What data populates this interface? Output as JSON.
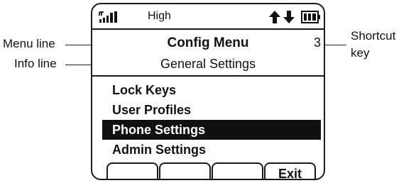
{
  "status_bar": {
    "signal_icon": "signal-strength-icon",
    "status_text": "High",
    "arrows_icon": "up-down-arrows-icon",
    "battery_icon": "battery-icon"
  },
  "menu_line": {
    "title": "Config Menu",
    "shortcut_key": "3"
  },
  "info_line": {
    "text": "General Settings"
  },
  "menu_items": [
    {
      "label": "Lock Keys",
      "selected": false
    },
    {
      "label": "User Profiles",
      "selected": false
    },
    {
      "label": "Phone Settings",
      "selected": true
    },
    {
      "label": "Admin Settings",
      "selected": false
    }
  ],
  "softkeys": [
    "",
    "",
    "",
    "Exit"
  ],
  "callouts": {
    "menu_line": "Menu line",
    "info_line": "Info line",
    "shortcut_key_line1": "Shortcut",
    "shortcut_key_line2": "key"
  }
}
